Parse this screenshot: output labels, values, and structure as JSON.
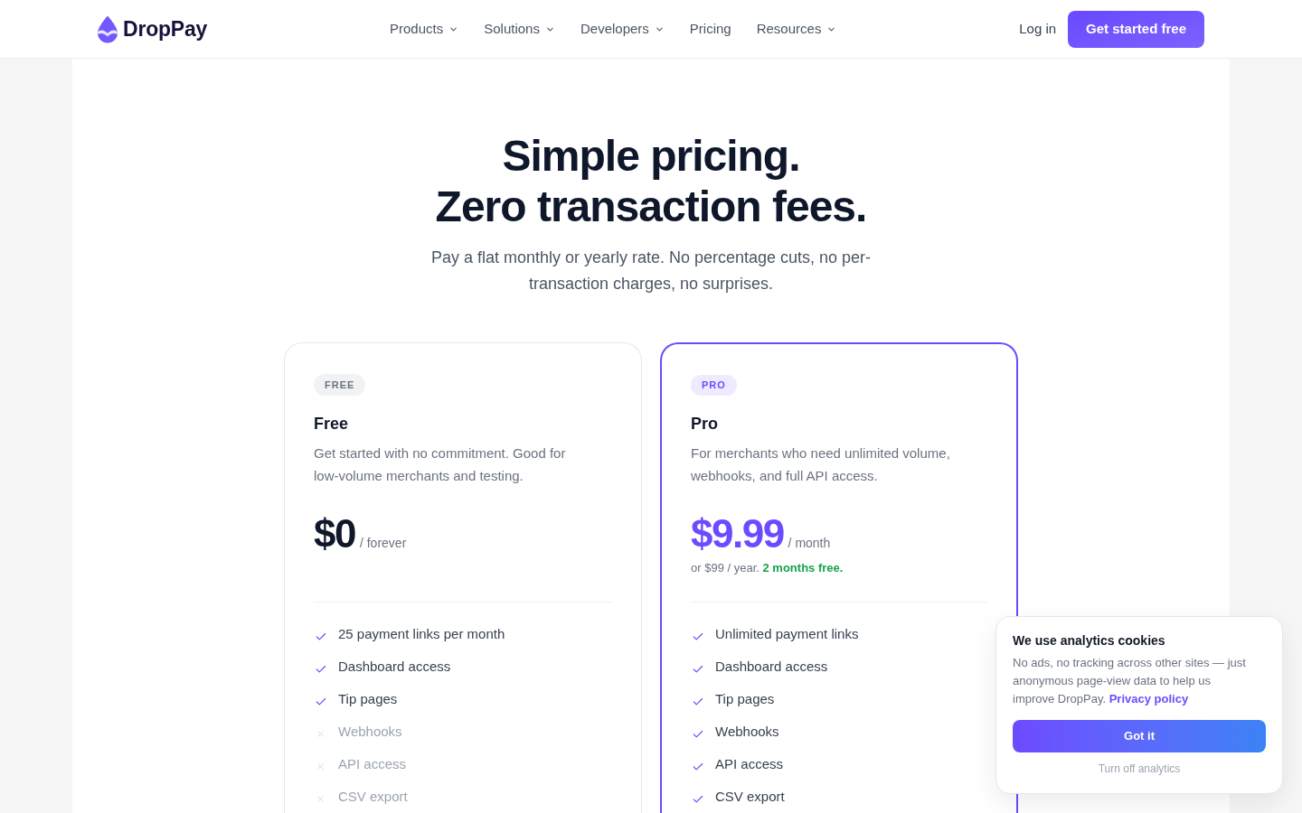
{
  "header": {
    "brand": "DropPay",
    "nav": [
      {
        "label": "Products",
        "dropdown": true
      },
      {
        "label": "Solutions",
        "dropdown": true
      },
      {
        "label": "Developers",
        "dropdown": true
      },
      {
        "label": "Pricing",
        "dropdown": false
      },
      {
        "label": "Resources",
        "dropdown": true
      }
    ],
    "login": "Log in",
    "cta": "Get started free"
  },
  "hero": {
    "title_lines": [
      "Simple pricing.",
      "Zero transaction fees."
    ],
    "subtitle": "Pay a flat monthly or yearly rate. No percentage cuts, no per-transaction charges, no surprises."
  },
  "plans": [
    {
      "badge": "FREE",
      "name": "Free",
      "featured": false,
      "description": "Get started with no commitment. Good for low-volume merchants and testing.",
      "price": "$0",
      "period": "/ forever",
      "features": [
        {
          "label": "25 payment links per month",
          "included": true
        },
        {
          "label": "Dashboard access",
          "included": true
        },
        {
          "label": "Tip pages",
          "included": true
        },
        {
          "label": "Webhooks",
          "included": false
        },
        {
          "label": "API access",
          "included": false
        },
        {
          "label": "CSV export",
          "included": false
        }
      ]
    },
    {
      "badge": "PRO",
      "name": "Pro",
      "featured": true,
      "description": "For merchants who need unlimited volume, webhooks, and full API access.",
      "price": "$9.99",
      "period": "/ month",
      "billing_note": {
        "text": "or $99 / year.",
        "highlight": "2 months free."
      },
      "features": [
        {
          "label": "Unlimited payment links",
          "included": true
        },
        {
          "label": "Dashboard access",
          "included": true
        },
        {
          "label": "Tip pages",
          "included": true
        },
        {
          "label": "Webhooks",
          "included": true
        },
        {
          "label": "API access",
          "included": true
        },
        {
          "label": "CSV export",
          "included": true
        }
      ]
    }
  ],
  "cookie_banner": {
    "title": "We use analytics cookies",
    "text": "No ads, no tracking across other sites — just anonymous page-view data to help us improve DropPay.",
    "link": "Privacy policy",
    "accept_button": "Got it",
    "decline_link": "Turn off analytics"
  }
}
